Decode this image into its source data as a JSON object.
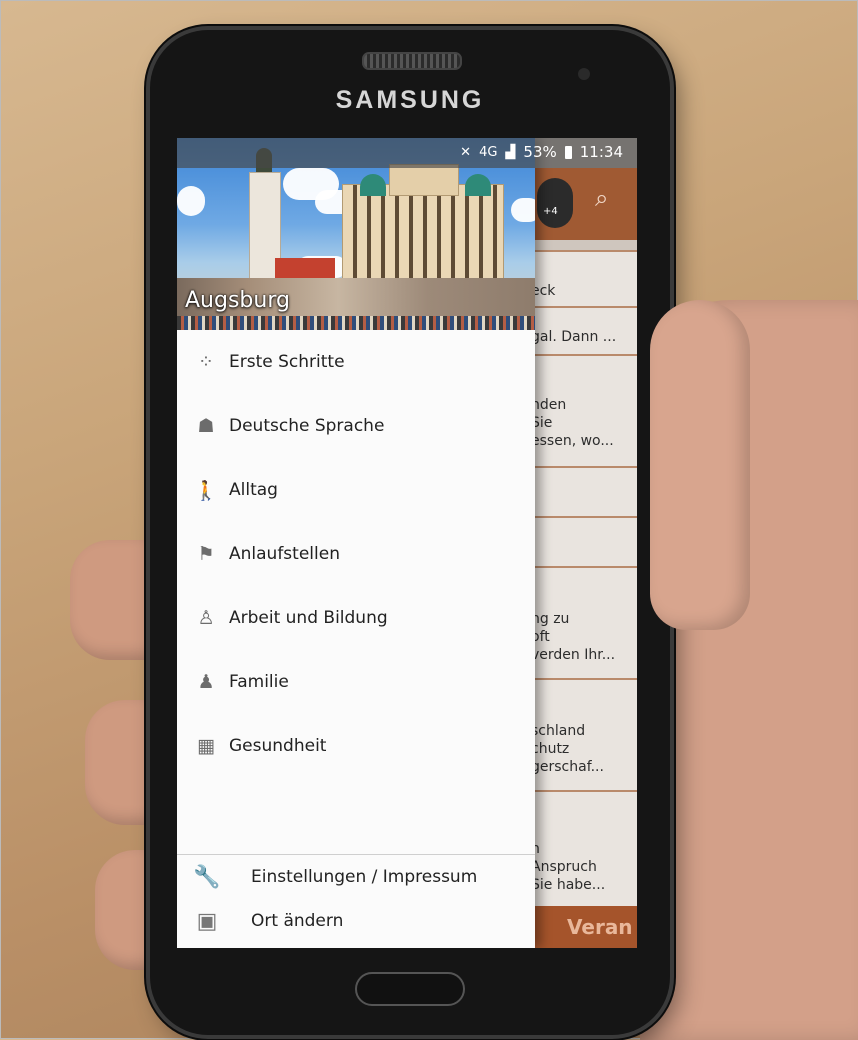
{
  "device": {
    "brand": "SAMSUNG"
  },
  "status_bar": {
    "battery": "53%",
    "time": "11:34",
    "network": "4G"
  },
  "drawer": {
    "city": "Augsburg",
    "items": [
      {
        "label": "Erste Schritte",
        "icon": "footsteps-icon"
      },
      {
        "label": "Deutsche Sprache",
        "icon": "classroom-icon"
      },
      {
        "label": "Alltag",
        "icon": "walking-person-icon"
      },
      {
        "label": "Anlaufstellen",
        "icon": "signpost-icon"
      },
      {
        "label": "Arbeit und Bildung",
        "icon": "worker-icon"
      },
      {
        "label": "Familie",
        "icon": "family-icon"
      },
      {
        "label": "Gesundheit",
        "icon": "hospital-icon"
      }
    ],
    "footer": [
      {
        "label": "Einstellungen / Impressum",
        "icon": "wrench-icon"
      },
      {
        "label": "Ort ändern",
        "icon": "map-icon"
      }
    ]
  },
  "background_app": {
    "cards": [
      {
        "text": "eck"
      },
      {
        "text": "gal. Dann ..."
      },
      {
        "text": "nden\nSie\nessen, wo..."
      },
      {
        "text": ""
      },
      {
        "text": ""
      },
      {
        "text": "ng zu\noft\nverden Ihr..."
      },
      {
        "text": "schland\nchutz\ngerschaf..."
      },
      {
        "text": "n\nAnspruch\nSie habe..."
      }
    ],
    "bottom_label": "Veran",
    "avatar_badge": "+4"
  }
}
